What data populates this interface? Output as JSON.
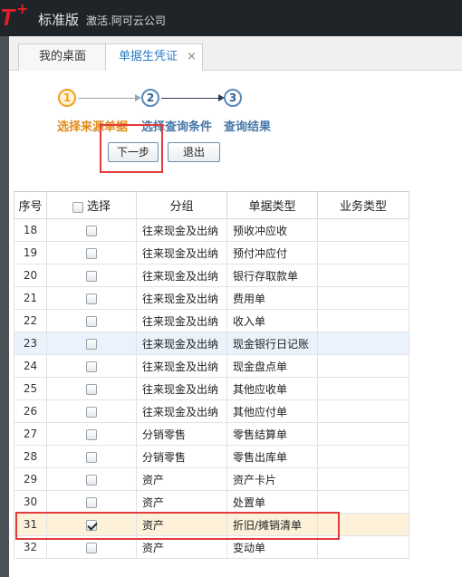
{
  "app": {
    "logo_text": "T",
    "logo_sup": "+",
    "edition": "标准版",
    "company": "激活.阿可云公司"
  },
  "tabs": [
    {
      "label": "我的桌面"
    },
    {
      "label": "单据生凭证",
      "close": "×"
    }
  ],
  "wizard": {
    "steps": [
      {
        "num": "1",
        "label": "选择来源单据",
        "state": "current"
      },
      {
        "num": "2",
        "label": "选择查询条件",
        "state": "pending"
      },
      {
        "num": "3",
        "label": "查询结果",
        "state": "pending"
      }
    ],
    "next_label": "下一步",
    "exit_label": "退出"
  },
  "table": {
    "headers": {
      "seq": "序号",
      "select": "选择",
      "group": "分组",
      "doc_type": "单据类型",
      "biz_type": "业务类型"
    },
    "rows": [
      {
        "seq": "18",
        "group": "往来现金及出纳",
        "doc_type": "预收冲应收",
        "checked": false
      },
      {
        "seq": "19",
        "group": "往来现金及出纳",
        "doc_type": "预付冲应付",
        "checked": false
      },
      {
        "seq": "20",
        "group": "往来现金及出纳",
        "doc_type": "银行存取款单",
        "checked": false
      },
      {
        "seq": "21",
        "group": "往来现金及出纳",
        "doc_type": "费用单",
        "checked": false
      },
      {
        "seq": "22",
        "group": "往来现金及出纳",
        "doc_type": "收入单",
        "checked": false
      },
      {
        "seq": "23",
        "group": "往来现金及出纳",
        "doc_type": "现金银行日记账",
        "checked": false
      },
      {
        "seq": "24",
        "group": "往来现金及出纳",
        "doc_type": "现金盘点单",
        "checked": false
      },
      {
        "seq": "25",
        "group": "往来现金及出纳",
        "doc_type": "其他应收单",
        "checked": false
      },
      {
        "seq": "26",
        "group": "往来现金及出纳",
        "doc_type": "其他应付单",
        "checked": false
      },
      {
        "seq": "27",
        "group": "分销零售",
        "doc_type": "零售结算单",
        "checked": false
      },
      {
        "seq": "28",
        "group": "分销零售",
        "doc_type": "零售出库单",
        "checked": false
      },
      {
        "seq": "29",
        "group": "资产",
        "doc_type": "资产卡片",
        "checked": false
      },
      {
        "seq": "30",
        "group": "资产",
        "doc_type": "处置单",
        "checked": false
      },
      {
        "seq": "31",
        "group": "资产",
        "doc_type": "折旧/摊销清单",
        "checked": true
      },
      {
        "seq": "32",
        "group": "资产",
        "doc_type": "变动单",
        "checked": false
      }
    ]
  },
  "colors": {
    "accent": "#2c7cc4",
    "current_step": "#f0a21d",
    "highlight": "#e23b3b",
    "selected_row": "#fdf1da"
  }
}
